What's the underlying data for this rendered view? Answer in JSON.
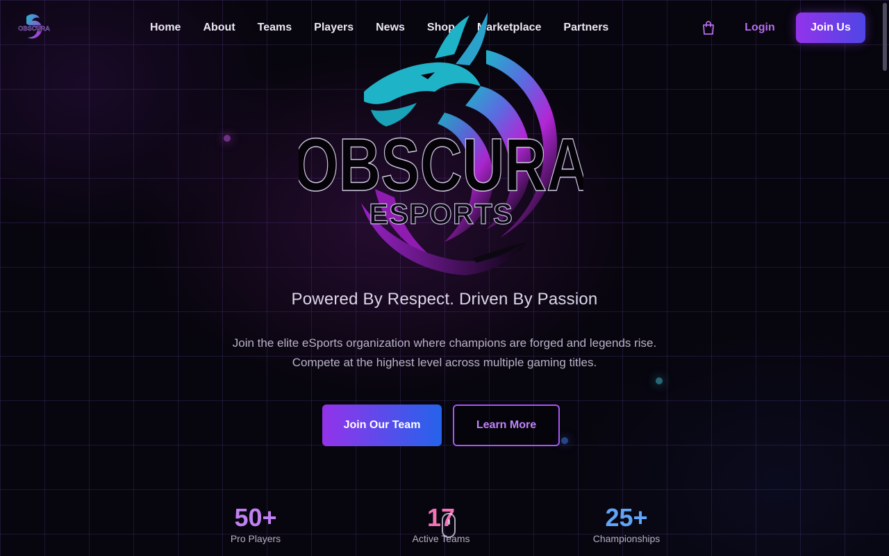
{
  "brand": {
    "logo_text": "OBSCURA"
  },
  "nav": {
    "items": [
      "Home",
      "About",
      "Teams",
      "Players",
      "News",
      "Shop",
      "Marketplace",
      "Partners"
    ],
    "cart_icon": "shopping-bag-icon",
    "login_label": "Login",
    "join_label": "Join Us"
  },
  "hero": {
    "logo": {
      "title": "OBSCURA",
      "subtitle": "ESPORTS"
    },
    "tagline": "Powered By Respect. Driven By Passion",
    "description_line1": "Join the elite eSports organization where champions are forged and legends rise.",
    "description_line2": "Compete at the highest level across multiple gaming titles.",
    "primary_cta": "Join Our Team",
    "secondary_cta": "Learn More"
  },
  "stats": [
    {
      "value": "50+",
      "label": "Pro Players",
      "color": "#c080f2"
    },
    {
      "value": "17",
      "label": "Active Teams",
      "color": "#f472b6"
    },
    {
      "value": "25+",
      "label": "Championships",
      "color": "#60a5fa"
    }
  ],
  "theme": {
    "accent_purple": "#9333ea",
    "accent_blue": "#2563eb",
    "accent_teal": "#22a7c0",
    "background": "#07050d"
  }
}
